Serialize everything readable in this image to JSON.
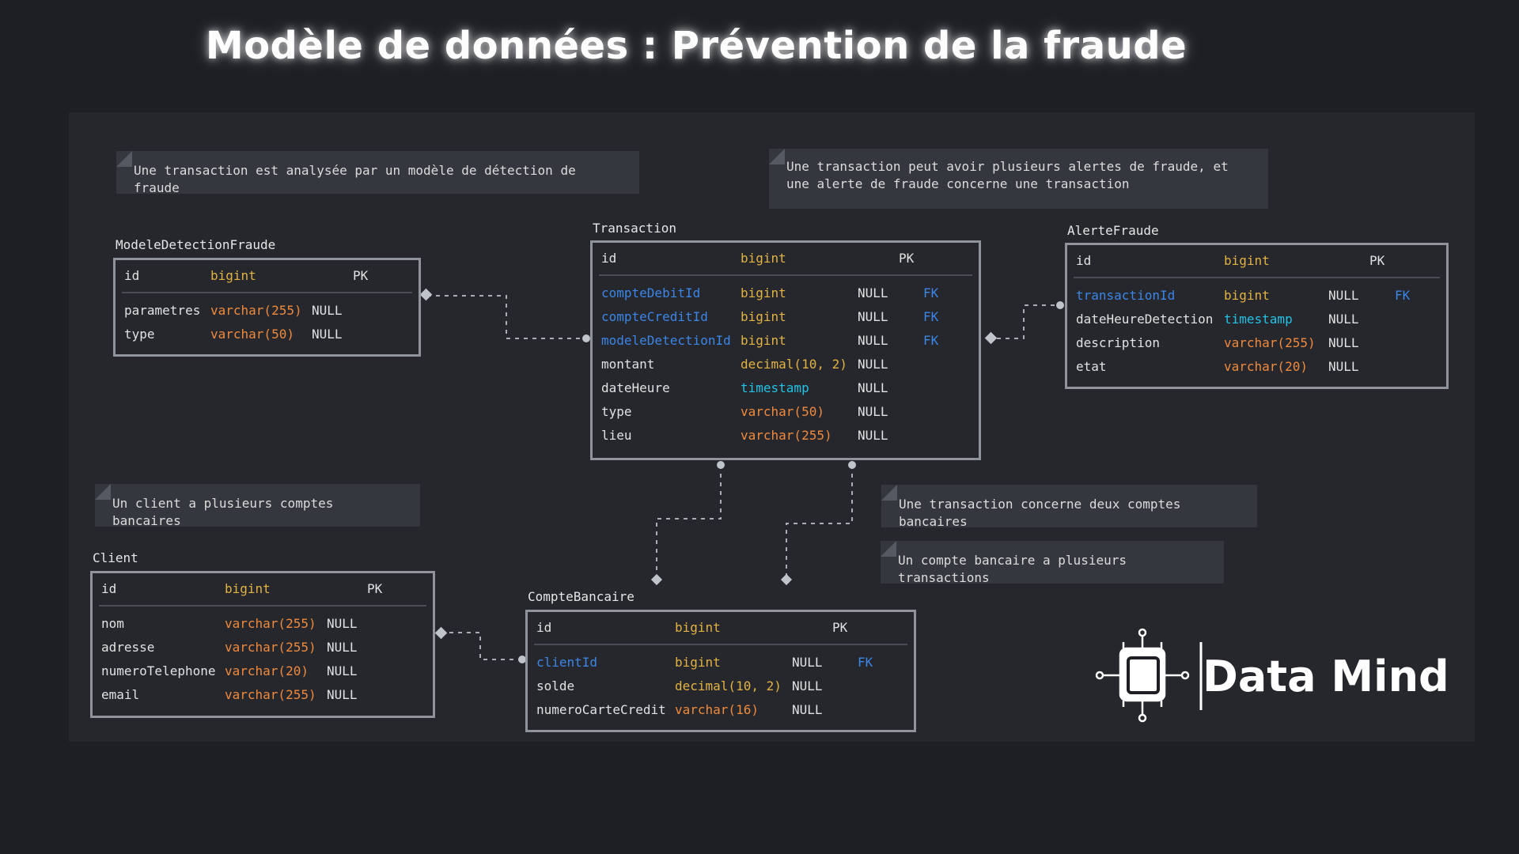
{
  "title": "Modèle  de données  : Prévention  de la fraude",
  "notes": [
    "Une transaction est analysée par un modèle de détection de fraude",
    "Une transaction peut avoir plusieurs alertes de fraude, et une alerte de fraude concerne une transaction",
    "Un client a plusieurs comptes bancaires",
    "Une transaction concerne deux comptes bancaires",
    "Un compte bancaire a plusieurs transactions"
  ],
  "entities": {
    "modele": {
      "name": "ModeleDetectionFraude",
      "columns": [
        {
          "name": "id",
          "type": "bigint",
          "null": "",
          "key": "PK"
        },
        {
          "name": "parametres",
          "type": "varchar(255)",
          "null": "NULL",
          "key": ""
        },
        {
          "name": "type",
          "type": "varchar(50)",
          "null": "NULL",
          "key": ""
        }
      ]
    },
    "transaction": {
      "name": "Transaction",
      "columns": [
        {
          "name": "id",
          "type": "bigint",
          "null": "",
          "key": "PK"
        },
        {
          "name": "compteDebitId",
          "type": "bigint",
          "null": "NULL",
          "key": "FK"
        },
        {
          "name": "compteCreditId",
          "type": "bigint",
          "null": "NULL",
          "key": "FK"
        },
        {
          "name": "modeleDetectionId",
          "type": "bigint",
          "null": "NULL",
          "key": "FK"
        },
        {
          "name": "montant",
          "type": "decimal(10, 2)",
          "null": "NULL",
          "key": ""
        },
        {
          "name": "dateHeure",
          "type": "timestamp",
          "null": "NULL",
          "key": ""
        },
        {
          "name": "type",
          "type": "varchar(50)",
          "null": "NULL",
          "key": ""
        },
        {
          "name": "lieu",
          "type": "varchar(255)",
          "null": "NULL",
          "key": ""
        }
      ]
    },
    "alerte": {
      "name": "AlerteFraude",
      "columns": [
        {
          "name": "id",
          "type": "bigint",
          "null": "",
          "key": "PK"
        },
        {
          "name": "transactionId",
          "type": "bigint",
          "null": "NULL",
          "key": "FK"
        },
        {
          "name": "dateHeureDetection",
          "type": "timestamp",
          "null": "NULL",
          "key": ""
        },
        {
          "name": "description",
          "type": "varchar(255)",
          "null": "NULL",
          "key": ""
        },
        {
          "name": "etat",
          "type": "varchar(20)",
          "null": "NULL",
          "key": ""
        }
      ]
    },
    "client": {
      "name": "Client",
      "columns": [
        {
          "name": "id",
          "type": "bigint",
          "null": "",
          "key": "PK"
        },
        {
          "name": "nom",
          "type": "varchar(255)",
          "null": "NULL",
          "key": ""
        },
        {
          "name": "adresse",
          "type": "varchar(255)",
          "null": "NULL",
          "key": ""
        },
        {
          "name": "numeroTelephone",
          "type": "varchar(20)",
          "null": "NULL",
          "key": ""
        },
        {
          "name": "email",
          "type": "varchar(255)",
          "null": "NULL",
          "key": ""
        }
      ]
    },
    "compte": {
      "name": "CompteBancaire",
      "columns": [
        {
          "name": "id",
          "type": "bigint",
          "null": "",
          "key": "PK"
        },
        {
          "name": "clientId",
          "type": "bigint",
          "null": "NULL",
          "key": "FK"
        },
        {
          "name": "solde",
          "type": "decimal(10, 2)",
          "null": "NULL",
          "key": ""
        },
        {
          "name": "numeroCarteCredit",
          "type": "varchar(16)",
          "null": "NULL",
          "key": ""
        }
      ]
    }
  },
  "brand": {
    "name": "Data Mind",
    "logo_icon": "chip-circuit-icon"
  },
  "colors": {
    "background": "#1d1f24",
    "canvas": "#25272d",
    "fk_column": "#3b86e6",
    "bigint": "#e3b341",
    "varchar": "#f08a3c",
    "timestamp": "#22c3e6"
  }
}
